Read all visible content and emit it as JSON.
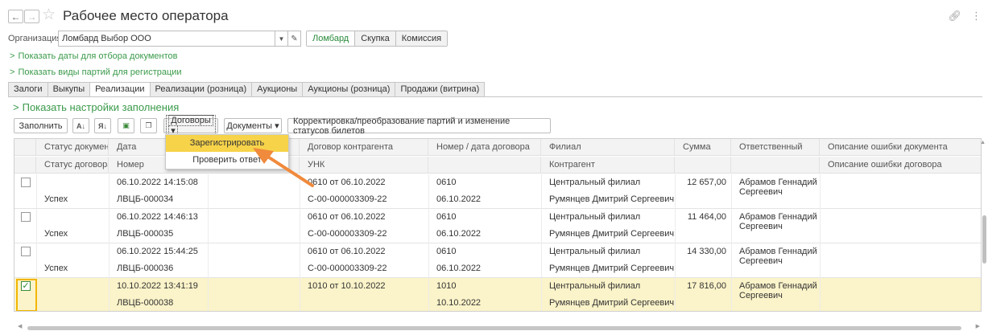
{
  "window": {
    "title": "Рабочее место оператора"
  },
  "org": {
    "label": "Организация:",
    "value": "Ломбард Выбор ООО",
    "segments": [
      "Ломбард",
      "Скупка",
      "Комиссия"
    ]
  },
  "links": {
    "show_dates": "Показать даты для отбора документов",
    "show_batch_types": "Показать виды партий для регистрации",
    "show_settings": "Показать настройки заполнения"
  },
  "tabs": [
    "Залоги",
    "Выкупы",
    "Реализации",
    "Реализации (розница)",
    "Аукционы",
    "Аукционы (розница)",
    "Продажи (витрина)"
  ],
  "active_tab": "Реализации",
  "toolbar": {
    "fill": "Заполнить",
    "contracts": "Договоры",
    "documents": "Документы",
    "correct": "Корректировка/преобразование партий и изменение статусов билетов",
    "dropdown_arrow": "▾"
  },
  "dropdown": {
    "items": [
      "Зарегистрировать",
      "Проверить ответ"
    ]
  },
  "columns": {
    "status_doc": "Статус документа",
    "status_contract": "Статус договора",
    "date": "Дата",
    "number": "Номер",
    "contract": "Договор контрагента",
    "unk": "УНК",
    "num_date": "Номер / дата договора",
    "branch": "Филиал",
    "counterparty": "Контрагент",
    "sum": "Сумма",
    "responsible": "Ответственный",
    "err_doc": "Описание ошибки документа",
    "err_contract": "Описание ошибки договора"
  },
  "rows": [
    {
      "checked": false,
      "status": "Успех",
      "date": "06.10.2022 14:15:08",
      "number": "ЛВЦБ-000034",
      "contract": "0610 от 06.10.2022",
      "unk": "С-00-000003309-22",
      "num": "0610",
      "cdate": "06.10.2022",
      "branch": "Центральный филиал",
      "counterparty": "Румянцев Дмитрий Сергеевич",
      "sum": "12 657,00",
      "resp1": "Абрамов Геннадий",
      "resp2": "Сергеевич"
    },
    {
      "checked": false,
      "status": "Успех",
      "date": "06.10.2022 14:46:13",
      "number": "ЛВЦБ-000035",
      "contract": "0610 от 06.10.2022",
      "unk": "С-00-000003309-22",
      "num": "0610",
      "cdate": "06.10.2022",
      "branch": "Центральный филиал",
      "counterparty": "Румянцев Дмитрий Сергеевич",
      "sum": "11 464,00",
      "resp1": "Абрамов Геннадий",
      "resp2": "Сергеевич"
    },
    {
      "checked": false,
      "status": "Успех",
      "date": "06.10.2022 15:44:25",
      "number": "ЛВЦБ-000036",
      "contract": "0610 от 06.10.2022",
      "unk": "С-00-000003309-22",
      "num": "0610",
      "cdate": "06.10.2022",
      "branch": "Центральный филиал",
      "counterparty": "Румянцев Дмитрий Сергеевич",
      "sum": "14 330,00",
      "resp1": "Абрамов Геннадий",
      "resp2": "Сергеевич"
    },
    {
      "checked": true,
      "status": "",
      "date": "10.10.2022 13:41:19",
      "number": "ЛВЦБ-000038",
      "contract": "1010 от 10.10.2022",
      "unk": "",
      "num": "1010",
      "cdate": "10.10.2022",
      "branch": "Центральный филиал",
      "counterparty": "Румянцев Дмитрий Сергеевич",
      "sum": "17 816,00",
      "resp1": "Абрамов Геннадий",
      "resp2": "Сергеевич"
    }
  ],
  "colors": {
    "accent_link": "#3a9a4a",
    "highlight": "#f7d34a",
    "selected_row": "#fbf3c9",
    "arrow": "#f08a3c"
  }
}
